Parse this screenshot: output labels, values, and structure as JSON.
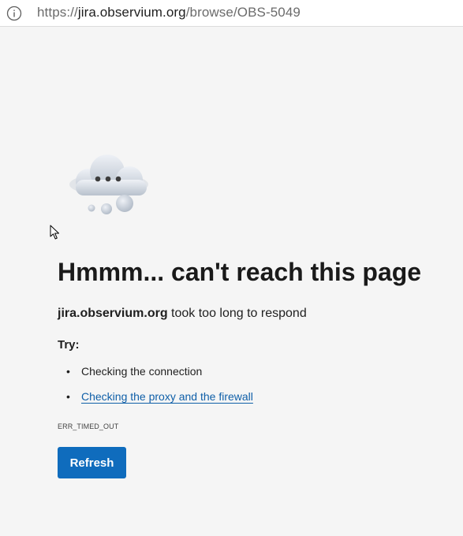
{
  "address_bar": {
    "url_prefix": "https://",
    "url_host": "jira.observium.org",
    "url_path": "/browse/OBS-5049",
    "icon": "info-icon"
  },
  "error_page": {
    "illustration": "cloud-icon",
    "headline": "Hmmm... can't reach this page",
    "host": "jira.observium.org",
    "message": " took too long to respond",
    "try_label": "Try:",
    "suggestions": [
      {
        "label": "Checking the connection",
        "link": false
      },
      {
        "label": "Checking the proxy and the firewall",
        "link": true
      }
    ],
    "error_code": "ERR_TIMED_OUT",
    "refresh_label": "Refresh"
  },
  "colors": {
    "background": "#f5f5f5",
    "link": "#0f5fa8",
    "button": "#0f6cbd"
  }
}
